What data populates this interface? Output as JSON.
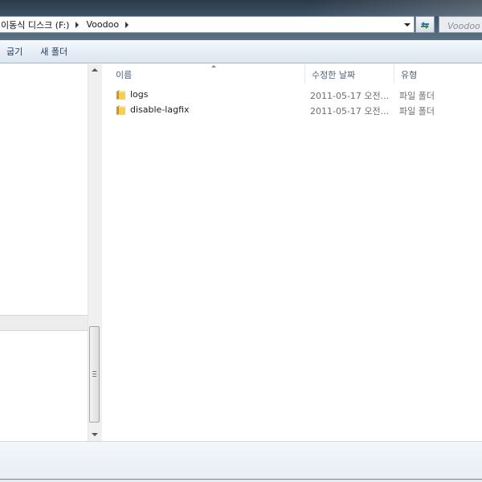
{
  "address_bar": {
    "crumbs": [
      "이동식 디스크 (F:)",
      "Voodoo"
    ],
    "refresh_icon": "refresh-icon"
  },
  "search": {
    "placeholder": "Voodoo 검색"
  },
  "command_bar": {
    "burn_label": "굽기",
    "new_folder_label": "새 폴더"
  },
  "file_list": {
    "columns": {
      "name": "이름",
      "date_modified": "수정한 날짜",
      "type": "유형"
    },
    "rows": [
      {
        "name": "logs",
        "date": "2011-05-17 오전...",
        "type": "파일 폴더",
        "icon": "folder-icon"
      },
      {
        "name": "disable-lagfix",
        "date": "2011-05-17 오전...",
        "type": "파일 폴더",
        "icon": "folder-icon"
      }
    ]
  },
  "colors": {
    "titlebar": "#3e5366",
    "command_text": "#1e395b",
    "column_header_text": "#4c607a",
    "folder": "#e8c04a"
  }
}
